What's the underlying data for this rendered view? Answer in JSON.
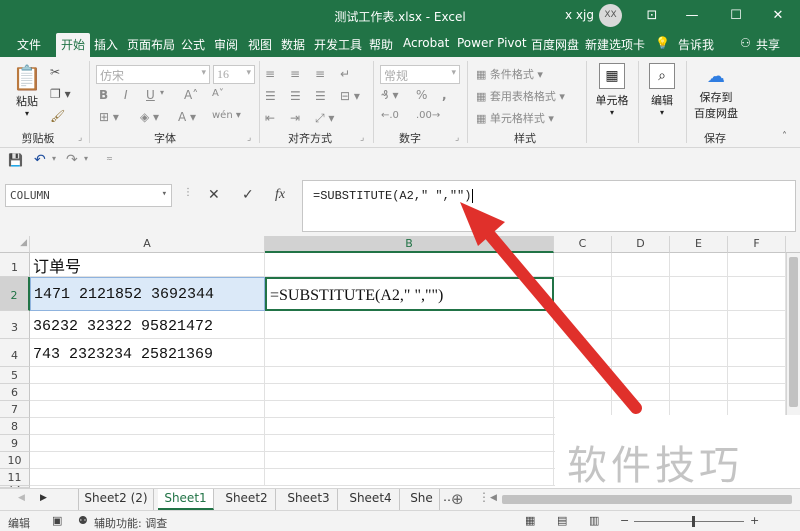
{
  "window": {
    "title": "测试工作表.xlsx  -  Excel",
    "user": "x xjg",
    "avatar_initials": "XX",
    "controls": [
      "restore-ribbon",
      "minimize",
      "maximize",
      "close"
    ]
  },
  "ribbon_tabs": [
    "文件",
    "开始",
    "插入",
    "页面布局",
    "公式",
    "审阅",
    "视图",
    "数据",
    "开发工具",
    "帮助",
    "Acrobat",
    "Power Pivot",
    "百度网盘",
    "新建选项卡",
    "告诉我",
    "共享"
  ],
  "active_tab": "开始",
  "ribbon": {
    "clipboard": {
      "paste": "粘贴",
      "group": "剪贴板"
    },
    "font": {
      "name": "仿宋",
      "size": "16",
      "group": "字体",
      "bold": "B",
      "italic": "I",
      "underline": "U",
      "grow": "A",
      "shrink": "A",
      "color_a": "A",
      "wen": "wén"
    },
    "alignment": {
      "group": "对齐方式"
    },
    "number": {
      "format": "常规",
      "group": "数字",
      "percent": "%",
      "comma": ","
    },
    "styles": {
      "conditional": "条件格式",
      "table": "套用表格格式",
      "cell": "单元格样式",
      "group": "样式"
    },
    "cells": {
      "label": "单元格"
    },
    "editing": {
      "label": "编辑"
    },
    "save": {
      "label_line1": "保存到",
      "label_line2": "百度网盘",
      "group": "保存"
    }
  },
  "formula_bar": {
    "name_box": "COLUMN",
    "formula": "=SUBSTITUTE(A2,\" \",\"\")",
    "cancel": "✕",
    "enter": "✓",
    "fx": "fx"
  },
  "columns": [
    "A",
    "B",
    "C",
    "D",
    "E",
    "F"
  ],
  "rows": [
    "1",
    "2",
    "3",
    "4",
    "5",
    "6",
    "7",
    "8",
    "9",
    "10",
    "11",
    "12"
  ],
  "cells": {
    "A1": "订单号",
    "A2": "1471 2121852 3692344",
    "B2": "=SUBSTITUTE(A2,\" \",\"\")",
    "A3": "36232 32322 95821472",
    "A4": "743 2323234 25821369"
  },
  "sheets": [
    "Sheet2 (2)",
    "Sheet1",
    "Sheet2",
    "Sheet3",
    "Sheet4",
    "She"
  ],
  "active_sheet": "Sheet1",
  "status": {
    "mode": "编辑",
    "accessibility": "辅助功能: 调查"
  },
  "watermark": "软件技巧",
  "colors": {
    "excel_green": "#217346",
    "arrow_red": "#e0302b",
    "selection_green": "#217346"
  }
}
